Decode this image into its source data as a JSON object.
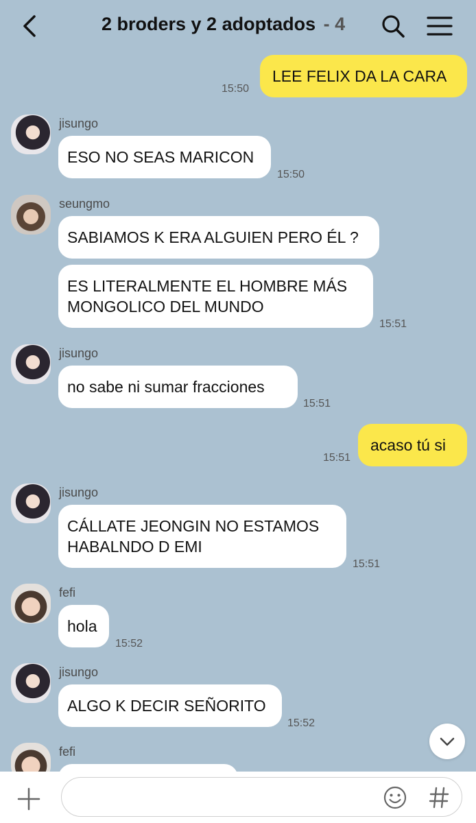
{
  "header": {
    "title": "2 broders y 2 adoptados",
    "member_count": "4"
  },
  "icons": {
    "back": "chevron-left-icon",
    "search": "search-icon",
    "menu": "hamburger-menu-icon",
    "scroll_down": "chevron-down-icon",
    "add": "plus-icon",
    "emoji": "emoji-icon",
    "hashtag": "hashtag-icon"
  },
  "colors": {
    "background": "#abc1d1",
    "my_bubble": "#fbe74b",
    "their_bubble": "#ffffff"
  },
  "messages": [
    {
      "sender": "me",
      "text": "LEE FELIX DA LA CARA",
      "time": "15:50"
    },
    {
      "sender": "jisungo",
      "text": "ESO NO SEAS MARICON",
      "time": "15:50"
    },
    {
      "sender": "seungmo",
      "text": "SABIAMOS K ERA ALGUIEN PERO ÉL ?",
      "time": ""
    },
    {
      "sender": "seungmo",
      "text": "ES LITERALMENTE EL HOMBRE MÁS\nMONGOLICO DEL MUNDO",
      "time": "15:51"
    },
    {
      "sender": "jisungo",
      "text": "no sabe ni sumar fracciones",
      "time": "15:51"
    },
    {
      "sender": "me",
      "text": "acaso tú si",
      "time": "15:51"
    },
    {
      "sender": "jisungo",
      "text": "CÁLLATE JEONGIN NO ESTAMOS\nHABALNDO D EMI",
      "time": "15:51"
    },
    {
      "sender": "fefi",
      "text": "hola",
      "time": "15:52"
    },
    {
      "sender": "jisungo",
      "text": "ALGO K DECIR SEÑORITO",
      "time": "15:52"
    },
    {
      "sender": "fefi",
      "text": "",
      "time": ""
    }
  ],
  "input": {
    "value": "",
    "placeholder": ""
  }
}
